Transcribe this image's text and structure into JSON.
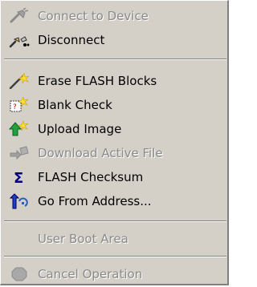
{
  "menu": {
    "items": [
      {
        "label": "Connect to Device",
        "icon": "connect-icon",
        "enabled": false
      },
      {
        "label": "Disconnect",
        "icon": "disconnect-icon",
        "enabled": true
      },
      {
        "label": "Erase FLASH Blocks",
        "icon": "erase-icon",
        "enabled": true
      },
      {
        "label": "Blank Check",
        "icon": "blank-check-icon",
        "enabled": true
      },
      {
        "label": "Upload Image",
        "icon": "upload-icon",
        "enabled": true
      },
      {
        "label": "Download Active File",
        "icon": "download-icon",
        "enabled": false
      },
      {
        "label": "FLASH Checksum",
        "icon": "sigma-icon",
        "enabled": true
      },
      {
        "label": "Go From Address...",
        "icon": "go-icon",
        "enabled": true
      },
      {
        "label": "User Boot Area",
        "icon": "",
        "enabled": false
      },
      {
        "label": "Cancel Operation",
        "icon": "stop-icon",
        "enabled": false
      }
    ]
  },
  "colors": {
    "menu_bg": "#d4d0c8",
    "disabled_text": "#8a8a8a",
    "text": "#000000"
  }
}
